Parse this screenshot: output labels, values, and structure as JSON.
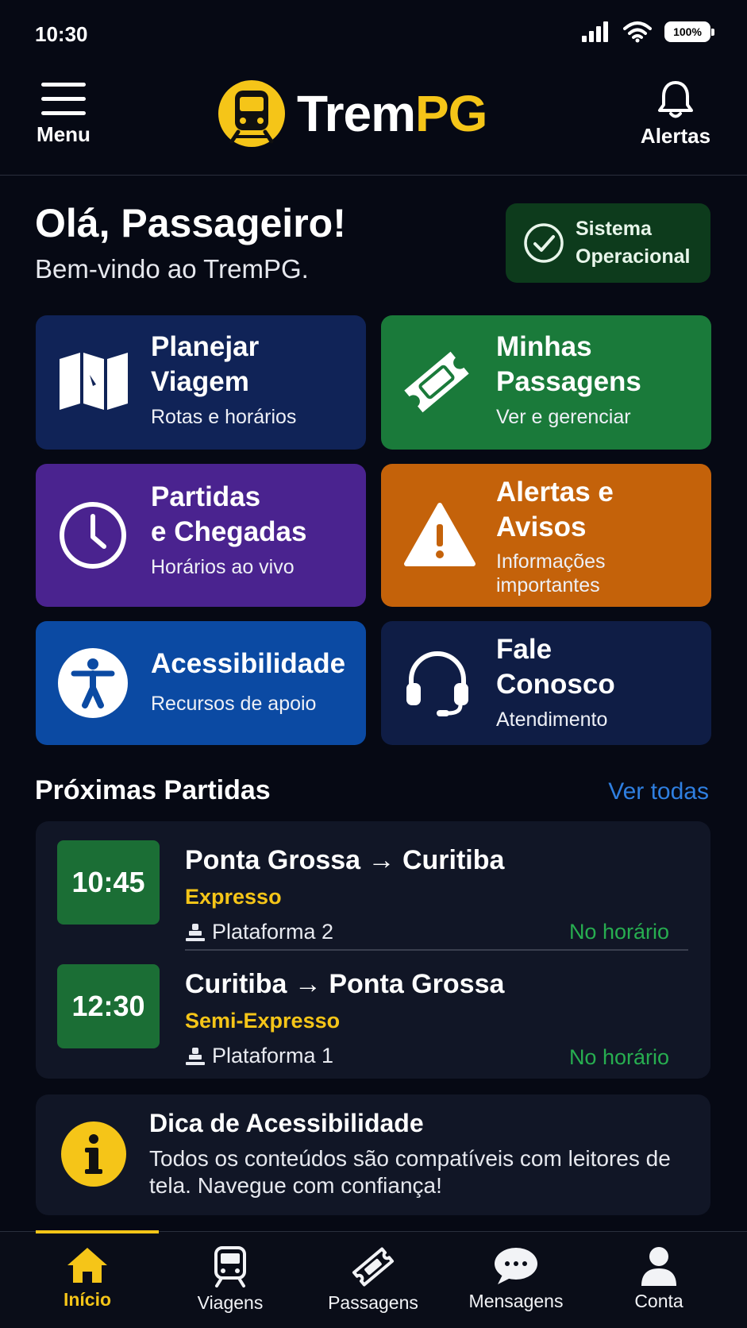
{
  "status_bar": {
    "time": "10:30",
    "battery": "100%"
  },
  "header": {
    "menu_label": "Menu",
    "brand_prefix": "Trem",
    "brand_suffix": "PG",
    "alerts_label": "Alertas",
    "brand_color": "#f5c518"
  },
  "greeting": {
    "title": "Olá, Passageiro!",
    "subtitle": "Bem-vindo ao TremPG.",
    "system_status_line1": "Sistema",
    "system_status_line2": "Operacional"
  },
  "tiles": [
    {
      "title_line1": "Planejar",
      "title_line2": "Viagem",
      "subtitle_line1": "Rotas e horários",
      "subtitle_line2": "",
      "color": "#102357",
      "icon": "map-icon"
    },
    {
      "title_line1": "Minhas",
      "title_line2": "Passagens",
      "subtitle_line1": "Ver e gerenciar",
      "subtitle_line2": "",
      "color": "#1a7a3a",
      "icon": "ticket-icon"
    },
    {
      "title_line1": "Partidas",
      "title_line2": "e Chegadas",
      "subtitle_line1": "Horários ao vivo",
      "subtitle_line2": "",
      "color": "#4a238f",
      "icon": "clock-icon"
    },
    {
      "title_line1": "Alertas e",
      "title_line2": "Avisos",
      "subtitle_line1": "Informações",
      "subtitle_line2": "importantes",
      "color": "#c4620a",
      "icon": "warning-icon"
    },
    {
      "title_line1": "Acessibilidade",
      "title_line2": "",
      "subtitle_line1": "Recursos de apoio",
      "subtitle_line2": "",
      "color": "#0b4aa3",
      "icon": "accessibility-icon"
    },
    {
      "title_line1": "Fale",
      "title_line2": "Conosco",
      "subtitle_line1": "Atendimento",
      "subtitle_line2": "",
      "color": "#0f1d45",
      "icon": "headset-icon"
    }
  ],
  "departures": {
    "title": "Próximas Partidas",
    "see_all": "Ver todas",
    "items": [
      {
        "time": "10:45",
        "route": "Ponta Grossa → Curitiba",
        "type": "Expresso",
        "platform": "Plataforma 2",
        "status": "No horário"
      },
      {
        "time": "12:30",
        "route": "Curitiba → Ponta Grossa",
        "type": "Semi-Expresso",
        "platform": "Plataforma 1",
        "status": "No horário"
      }
    ]
  },
  "tip": {
    "title": "Dica de Acessibilidade",
    "text": "Todos os conteúdos são compatíveis com leitores de tela. Navegue com confiança!"
  },
  "bottom_nav": [
    {
      "label": "Início",
      "icon": "home-icon",
      "active": true
    },
    {
      "label": "Viagens",
      "icon": "train-icon",
      "active": false
    },
    {
      "label": "Passagens",
      "icon": "ticket-icon",
      "active": false
    },
    {
      "label": "Mensagens",
      "icon": "chat-icon",
      "active": false
    },
    {
      "label": "Conta",
      "icon": "user-icon",
      "active": false
    }
  ]
}
